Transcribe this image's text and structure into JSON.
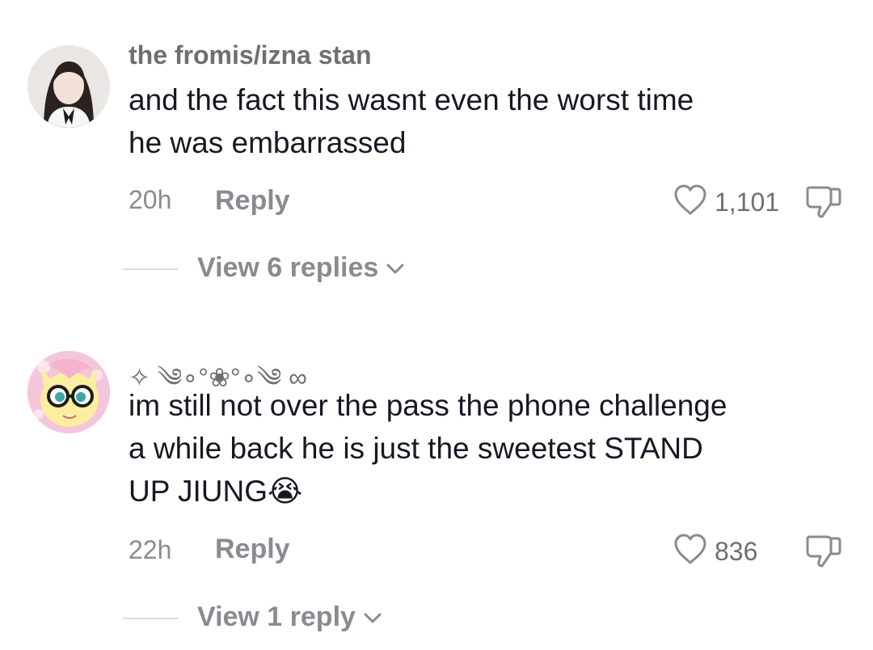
{
  "comments": [
    {
      "username": "the fromis/izna stan",
      "text_lines": [
        "and the fact this wasnt even the worst time",
        "he was embarrassed"
      ],
      "time": "20h",
      "reply_label": "Reply",
      "likes": "1,101",
      "view_replies": "View 6 replies"
    },
    {
      "username": "✧ ༄∘°❀°∘༄ ∞",
      "text_lines": [
        "im still not over the pass the phone challenge",
        "a while back he is just the sweetest STAND",
        "UP JIUNG😭"
      ],
      "time": "22h",
      "reply_label": "Reply",
      "likes": "836",
      "view_replies": "View 1 reply"
    }
  ],
  "icons": {
    "like": "heart-outline-icon",
    "dislike": "thumbs-down-outline-icon",
    "chevron": "chevron-down-icon"
  },
  "colors": {
    "text": "#161823",
    "secondary": "#8a8b91",
    "divider": "#dcdcdd"
  }
}
